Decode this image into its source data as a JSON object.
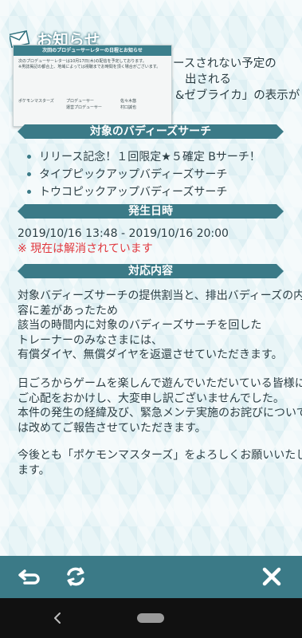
{
  "header": {
    "title": "お知らせ"
  },
  "intro_lines": [
    "ースされない予定の",
    "出される",
    "&ゼブライカ」の表示が"
  ],
  "letter": {
    "title": "次回のプロデューサーレターの日程とお知らせ",
    "body_1": "次のプロデューサーレターは10月17日(木)の配信を予定しております。",
    "body_2": "※男誌掲記の都合上、地域によっては視聴までお時間を頂く場合がございます。",
    "sign_left": "ポケモンマスターズ",
    "sign_role_1": "プロデューサー",
    "sign_role_2": "運営プロデューサー",
    "sign_name_1": "佐々木悠",
    "sign_name_2": "村口誠也"
  },
  "sections": {
    "target": {
      "heading": "対象のバディーズサーチ",
      "items": [
        "リリース記念！１回限定★５確定 Bサーチ！",
        "タイプピックアップバディーズサーチ",
        "トウコピックアップバディーズサーチ"
      ]
    },
    "date": {
      "heading": "発生日時",
      "period": "2019/10/16 13:48 - 2019/10/16 20:00",
      "status": "※ 現在は解消されています"
    },
    "response": {
      "heading": "対応内容",
      "para1": [
        "対象バディーズサーチの提供割当と、排出バディーズの内",
        "容に差があったため",
        "該当の時間内に対象のバディーズサーチを回した",
        "トレーナーのみなさまには、",
        "有償ダイヤ、無償ダイヤを返還させていただきます。"
      ],
      "para2": [
        "日ごろからゲームを楽しんで遊んでいただいている皆様に",
        "ご心配をおかけし、大変申し訳ございませんでした。",
        "本件の発生の経緯及び、緊急メンテ実施のお詫びについて",
        "は改めてご報告させていただきます。"
      ],
      "para3": [
        "今後とも「ポケモンマスターズ」をよろしくお願いいたし",
        "ます。"
      ]
    }
  },
  "colors": {
    "accent": "#3b7a87",
    "alert": "#e0373d",
    "background": "#e9f5f7"
  },
  "icons": [
    "mail-icon",
    "back-arrow-icon",
    "refresh-icon",
    "close-icon",
    "nav-back-icon",
    "nav-home-pill"
  ]
}
